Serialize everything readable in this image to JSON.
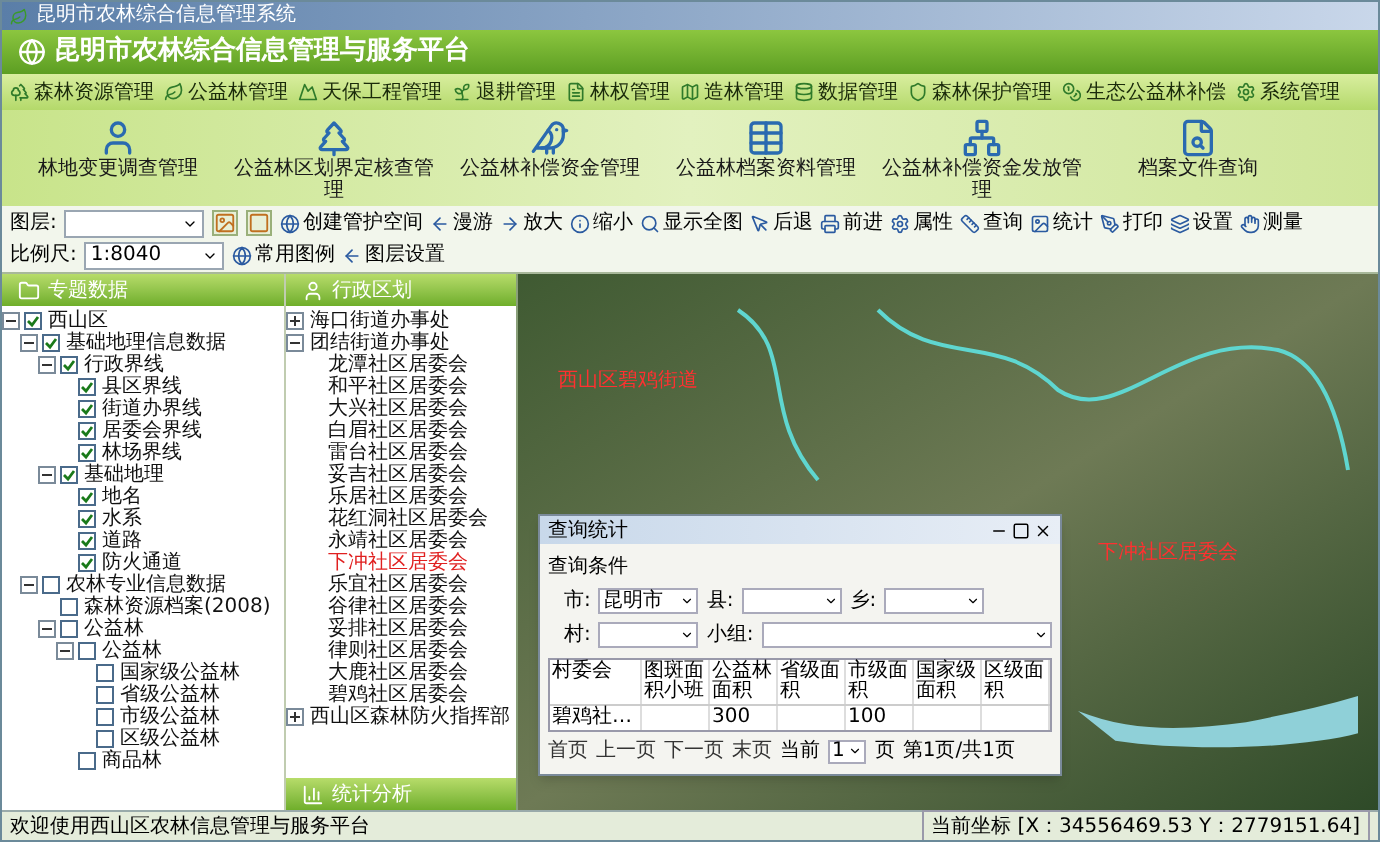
{
  "window": {
    "title": "昆明市农林综合信息管理系统"
  },
  "header": {
    "title": "昆明市农林综合信息管理与服务平台"
  },
  "menu": [
    {
      "label": "森林资源管理"
    },
    {
      "label": "公益林管理"
    },
    {
      "label": "天保工程管理"
    },
    {
      "label": "退耕管理"
    },
    {
      "label": "林权管理"
    },
    {
      "label": "造林管理"
    },
    {
      "label": "数据管理"
    },
    {
      "label": "森林保护管理"
    },
    {
      "label": "生态公益林补偿"
    },
    {
      "label": "系统管理"
    }
  ],
  "ribbon": [
    {
      "label": "林地变更调查管理"
    },
    {
      "label": "公益林区划界定核查管理"
    },
    {
      "label": "公益林补偿资金管理"
    },
    {
      "label": "公益林档案资料管理"
    },
    {
      "label": "公益林补偿资金发放管理"
    },
    {
      "label": "档案文件查询"
    }
  ],
  "toolbar": [
    {
      "kind": "label",
      "text": "图层:"
    },
    {
      "kind": "combo"
    },
    {
      "kind": "icon"
    },
    {
      "kind": "icon"
    },
    {
      "kind": "button",
      "label": "创建管护空间"
    },
    {
      "kind": "button",
      "label": "漫游"
    },
    {
      "kind": "button",
      "label": "放大"
    },
    {
      "kind": "button",
      "label": "缩小"
    },
    {
      "kind": "button",
      "label": "显示全图"
    },
    {
      "kind": "button",
      "label": "后退"
    },
    {
      "kind": "button",
      "label": "前进"
    },
    {
      "kind": "button",
      "label": "属性"
    },
    {
      "kind": "button",
      "label": "查询"
    },
    {
      "kind": "button",
      "label": "统计"
    },
    {
      "kind": "button",
      "label": "打印"
    },
    {
      "kind": "button",
      "label": "设置"
    },
    {
      "kind": "button",
      "label": "测量"
    },
    {
      "kind": "label",
      "text": "比例尺:"
    },
    {
      "kind": "combo",
      "value": "1:8040"
    },
    {
      "kind": "button",
      "label": "常用图例"
    },
    {
      "kind": "button",
      "label": "图层设置"
    }
  ],
  "panels": [
    {
      "title": "专题数据",
      "tree": [
        {
          "label": "西山区",
          "expanded": true,
          "checked": true,
          "children": [
            {
              "label": "基础地理信息数据",
              "expanded": true,
              "checked": true,
              "children": [
                {
                  "label": "行政界线",
                  "expanded": true,
                  "checked": true,
                  "children": [
                    {
                      "label": "县区界线",
                      "checked": true
                    },
                    {
                      "label": "街道办界线",
                      "checked": true
                    },
                    {
                      "label": "居委会界线",
                      "checked": true
                    },
                    {
                      "label": "林场界线",
                      "checked": true
                    }
                  ]
                },
                {
                  "label": "基础地理",
                  "expanded": true,
                  "checked": true,
                  "children": [
                    {
                      "label": "地名",
                      "checked": true
                    },
                    {
                      "label": "水系",
                      "checked": true
                    },
                    {
                      "label": "道路",
                      "checked": true
                    },
                    {
                      "label": "防火通道",
                      "checked": true
                    }
                  ]
                }
              ]
            },
            {
              "label": "农林专业信息数据",
              "expanded": true,
              "checked": false,
              "children": [
                {
                  "label": "森林资源档案(2008)",
                  "checked": false
                },
                {
                  "label": "公益林",
                  "expanded": true,
                  "checked": false,
                  "children": [
                    {
                      "label": "公益林",
                      "expanded": true,
                      "checked": false,
                      "children": [
                        {
                          "label": "国家级公益林",
                          "checked": false
                        },
                        {
                          "label": "省级公益林",
                          "checked": false
                        },
                        {
                          "label": "市级公益林",
                          "checked": false
                        },
                        {
                          "label": "区级公益林",
                          "checked": false
                        }
                      ]
                    },
                    {
                      "label": "商品林",
                      "checked": false
                    }
                  ]
                }
              ]
            }
          ]
        }
      ]
    },
    {
      "title": "行政区划",
      "tree": [
        {
          "label": "海口街道办事处",
          "expanded": false,
          "selected": false
        },
        {
          "label": "团结街道办事处",
          "expanded": true,
          "selected": false,
          "children": [
            {
              "label": "龙潭社区居委会",
              "selected": false
            },
            {
              "label": "和平社区居委会",
              "selected": false
            },
            {
              "label": "大兴社区居委会",
              "selected": false
            },
            {
              "label": "白眉社区居委会",
              "selected": false
            },
            {
              "label": "雷台社区居委会",
              "selected": false
            },
            {
              "label": "妥吉社区居委会",
              "selected": false
            },
            {
              "label": "乐居社区居委会",
              "selected": false
            },
            {
              "label": "花红洞社区居委会",
              "selected": false
            },
            {
              "label": "永靖社区居委会",
              "selected": false
            },
            {
              "label": "下冲社区居委会",
              "selected": true
            },
            {
              "label": "乐宜社区居委会",
              "selected": false
            },
            {
              "label": "谷律社区居委会",
              "selected": false
            },
            {
              "label": "妥排社区居委会",
              "selected": false
            },
            {
              "label": "律则社区居委会",
              "selected": false
            },
            {
              "label": "大鹿社区居委会",
              "selected": false
            },
            {
              "label": "碧鸡社区居委会",
              "selected": false
            }
          ]
        },
        {
          "label": "西山区森林防火指挥部",
          "expanded": false,
          "selected": false
        }
      ]
    },
    {
      "title": "统计分析"
    }
  ],
  "map": {
    "labels": [
      "西山区碧鸡街道",
      "下冲社区居委会"
    ]
  },
  "dialog": {
    "title": "查询统计",
    "group": "查询条件",
    "fields": [
      {
        "label": "市:",
        "value": "昆明市"
      },
      {
        "label": "县:"
      },
      {
        "label": "乡:"
      },
      {
        "label": "村:"
      },
      {
        "label": "小组:"
      }
    ],
    "columns": [
      "村委会",
      "图斑面积小班",
      "公益林面积",
      "省级面积",
      "市级面积",
      "国家级面积",
      "区级面积"
    ],
    "rows": [
      [
        "碧鸡社…",
        null,
        "300",
        null,
        "100",
        null,
        null
      ]
    ],
    "pager": [
      "首页",
      "上一页",
      "下一页",
      "末页"
    ],
    "current_label": "当前",
    "current_page": "1",
    "page_unit": "页",
    "page_info": "第1页/共1页"
  },
  "status_bar": {
    "message": "欢迎使用西山区农林信息管理与服务平台",
    "coordinates": "当前坐标 [X：34556469.53 Y：2779151.64]"
  }
}
